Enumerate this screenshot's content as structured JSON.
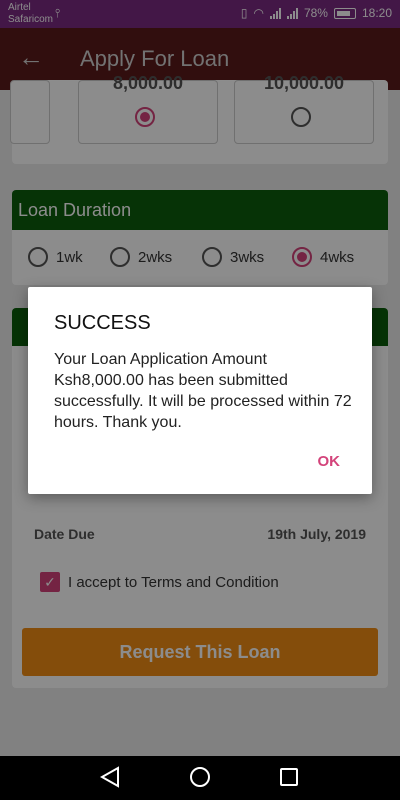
{
  "status_bar": {
    "carrier_1": "Airtel",
    "carrier_2": "Safaricom",
    "battery_percent": "78%",
    "time": "18:20"
  },
  "app_bar": {
    "title": "Apply For Loan"
  },
  "loan_amount": {
    "options": [
      {
        "value": "",
        "selected": false
      },
      {
        "value": "8,000.00",
        "selected": true
      },
      {
        "value": "10,000.00",
        "selected": false
      }
    ]
  },
  "loan_duration": {
    "title": "Loan Duration",
    "options": [
      {
        "label": "1wk",
        "selected": false
      },
      {
        "label": "2wks",
        "selected": false
      },
      {
        "label": "3wks",
        "selected": false
      },
      {
        "label": "4wks",
        "selected": true
      }
    ]
  },
  "loan_details": {
    "date_due_label": "Date Due",
    "date_due_value": "19th July, 2019",
    "terms_label": "I accept to Terms and Condition",
    "terms_checked": true,
    "request_button": "Request This Loan"
  },
  "dialog": {
    "title": "SUCCESS",
    "message": "Your Loan Application Amount Ksh8,000.00 has been submitted successfully. It will be processed within 72 hours. Thank you.",
    "ok_label": "OK"
  },
  "colors": {
    "status_bar": "#7b2a82",
    "app_bar": "#5a1a1a",
    "section_header": "#0b5d0b",
    "accent": "#d3437a",
    "button": "#f08c14"
  }
}
